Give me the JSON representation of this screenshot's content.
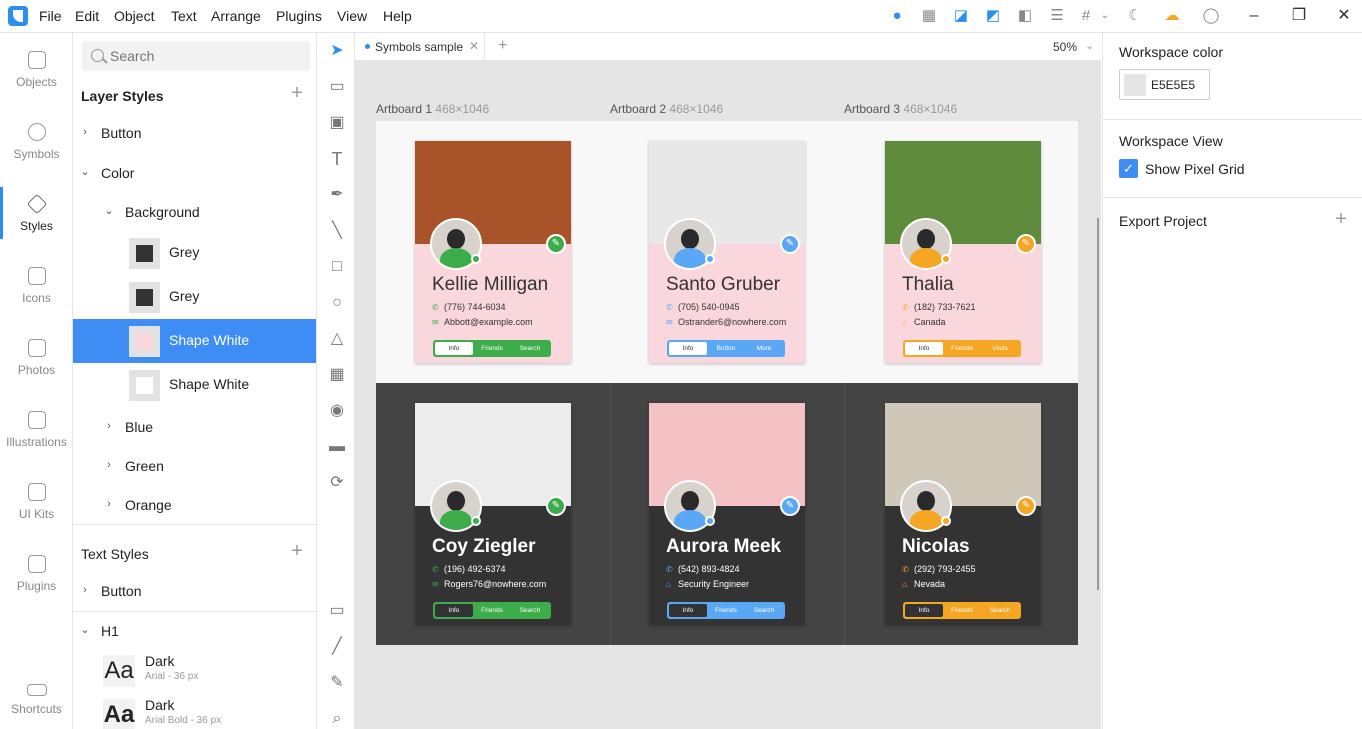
{
  "menu": [
    "File",
    "Edit",
    "Object",
    "Text",
    "Arrange",
    "Plugins",
    "View",
    "Help"
  ],
  "leftnav": [
    {
      "label": "Objects",
      "icon": "objects-icon"
    },
    {
      "label": "Symbols",
      "icon": "symbols-icon"
    },
    {
      "label": "Styles",
      "icon": "styles-icon",
      "active": true
    },
    {
      "label": "Icons",
      "icon": "icons-icon"
    },
    {
      "label": "Photos",
      "icon": "photos-icon"
    },
    {
      "label": "Illustrations",
      "icon": "illustrations-icon"
    },
    {
      "label": "UI Kits",
      "icon": "ui-kits-icon"
    },
    {
      "label": "Plugins",
      "icon": "plugins-icon"
    },
    {
      "label": "Shortcuts",
      "icon": "keyboard-icon"
    }
  ],
  "panel": {
    "search_placeholder": "Search",
    "layer_styles_title": "Layer Styles",
    "layer_tree": {
      "button": "Button",
      "color": "Color",
      "background": "Background",
      "swatches": [
        {
          "label": "Grey",
          "color": "#333333"
        },
        {
          "label": "Grey",
          "color": "#333333"
        },
        {
          "label": "Shape White",
          "color": "#f9d7dc",
          "selected": true
        },
        {
          "label": "Shape White",
          "color": "#ffffff"
        }
      ],
      "blue": "Blue",
      "green": "Green",
      "orange": "Orange"
    },
    "text_styles_title": "Text Styles",
    "text_tree": {
      "button": "Button",
      "h1": "H1",
      "styles": [
        {
          "aa": "Aa",
          "name": "Dark",
          "sub": "Arial  - 36 px"
        },
        {
          "aa": "Aa",
          "name": "Dark",
          "sub": "Arial Bold - 36 px"
        }
      ]
    }
  },
  "tab": {
    "name": "Symbols sample",
    "zoom": "50%"
  },
  "artboards": [
    {
      "label": "Artboard 1",
      "size": "468×1046"
    },
    {
      "label": "Artboard 2",
      "size": "468×1046"
    },
    {
      "label": "Artboard 3",
      "size": "468×1046"
    }
  ],
  "cards": [
    {
      "name": "Kellie Milligan",
      "l1": "(776) 744-6034",
      "l2": "Abbott@example.com",
      "tabs": [
        "Info",
        "Friends",
        "Search"
      ],
      "accent": "#3dac4a",
      "theme": "light",
      "photo": "#a8532a",
      "l2icon": "✉"
    },
    {
      "name": "Santo Gruber",
      "l1": "(705) 540-0945",
      "l2": "Ostrander6@nowhere.com",
      "tabs": [
        "Info",
        "Button",
        "More"
      ],
      "accent": "#5aa8f5",
      "theme": "light",
      "photo": "#e8e8e8",
      "l2icon": "✉"
    },
    {
      "name": "Thalia",
      "l1": "(182) 733-7621",
      "l2": "Canada",
      "tabs": [
        "Info",
        "Friends",
        "Visits"
      ],
      "accent": "#f5a623",
      "theme": "light",
      "photo": "#5e8a3c",
      "l2icon": "⌂"
    },
    {
      "name": "Coy Ziegler",
      "l1": "(196) 492-6374",
      "l2": "Rogers76@nowhere.com",
      "tabs": [
        "Info",
        "Friends",
        "Search"
      ],
      "accent": "#3dac4a",
      "theme": "dark",
      "photo": "#ececec",
      "l2icon": "✉"
    },
    {
      "name": "Aurora Meek",
      "l1": "(542) 893-4824",
      "l2": "Security Engineer",
      "tabs": [
        "Info",
        "Friends",
        "Search"
      ],
      "accent": "#5aa8f5",
      "theme": "dark",
      "photo": "#f4c2c4",
      "l2icon": "⌂"
    },
    {
      "name": "Nicolas",
      "l1": "(292) 793-2455",
      "l2": "Nevada",
      "tabs": [
        "Info",
        "Friends",
        "Search"
      ],
      "accent": "#f5a623",
      "theme": "dark",
      "photo": "#cfc8b8",
      "l2icon": "⌂"
    }
  ],
  "props": {
    "workspace_color_title": "Workspace color",
    "workspace_color_hex": "E5E5E5",
    "workspace_color": "#e5e5e5",
    "workspace_view_title": "Workspace View",
    "show_pixel_grid": "Show Pixel Grid",
    "show_pixel_grid_checked": true,
    "export_title": "Export Project"
  },
  "colors": {
    "accent": "#2b8ff0",
    "selection": "#3d8df5"
  }
}
